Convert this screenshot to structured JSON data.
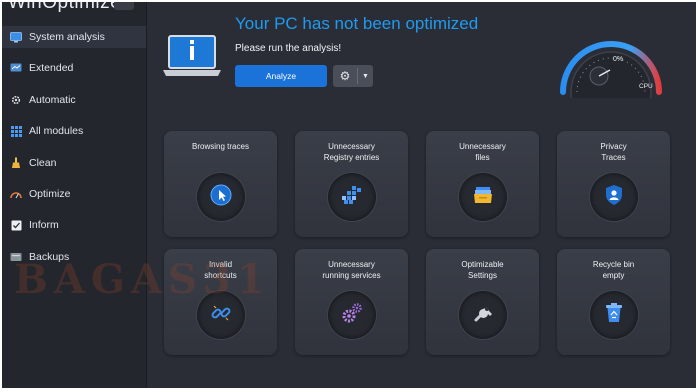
{
  "app": {
    "title": "WinOptimizer"
  },
  "sidebar": {
    "items": [
      {
        "label": "System analysis",
        "icon": "system-analysis-icon"
      },
      {
        "label": "Extended",
        "icon": "extended-icon"
      },
      {
        "label": "Automatic",
        "icon": "automatic-gear-icon"
      },
      {
        "label": "All modules",
        "icon": "grid-icon"
      },
      {
        "label": "Clean",
        "icon": "broom-icon"
      },
      {
        "label": "Optimize",
        "icon": "speedometer-icon"
      },
      {
        "label": "Inform",
        "icon": "checkbox-icon"
      },
      {
        "label": "Backups",
        "icon": "backup-drive-icon"
      }
    ]
  },
  "status": {
    "headline": "Your PC has not been optimized",
    "subline": "Please run the analysis!"
  },
  "toolbar": {
    "analyze_label": "Analyze"
  },
  "gauge": {
    "value_label": "0%",
    "caption": "CPU",
    "value": 0
  },
  "tiles": [
    {
      "label": "Browsing traces",
      "icon": "cursor-icon"
    },
    {
      "label": "Unnecessary\nRegistry entries",
      "icon": "registry-blocks-icon"
    },
    {
      "label": "Unnecessary\nfiles",
      "icon": "files-folder-icon"
    },
    {
      "label": "Privacy\nTraces",
      "icon": "privacy-shield-icon"
    },
    {
      "label": "Invalid\nshortcuts",
      "icon": "broken-link-icon"
    },
    {
      "label": "Unnecessary\nrunning services",
      "icon": "services-gears-icon"
    },
    {
      "label": "Optimizable\nSettings",
      "icon": "wrench-icon"
    },
    {
      "label": "Recycle bin\nempty",
      "icon": "recycle-bin-icon"
    }
  ],
  "colors": {
    "accent": "#1b72d8",
    "headline": "#1f9bf0",
    "background": "#2a2d36",
    "sidebar": "#23262d"
  }
}
